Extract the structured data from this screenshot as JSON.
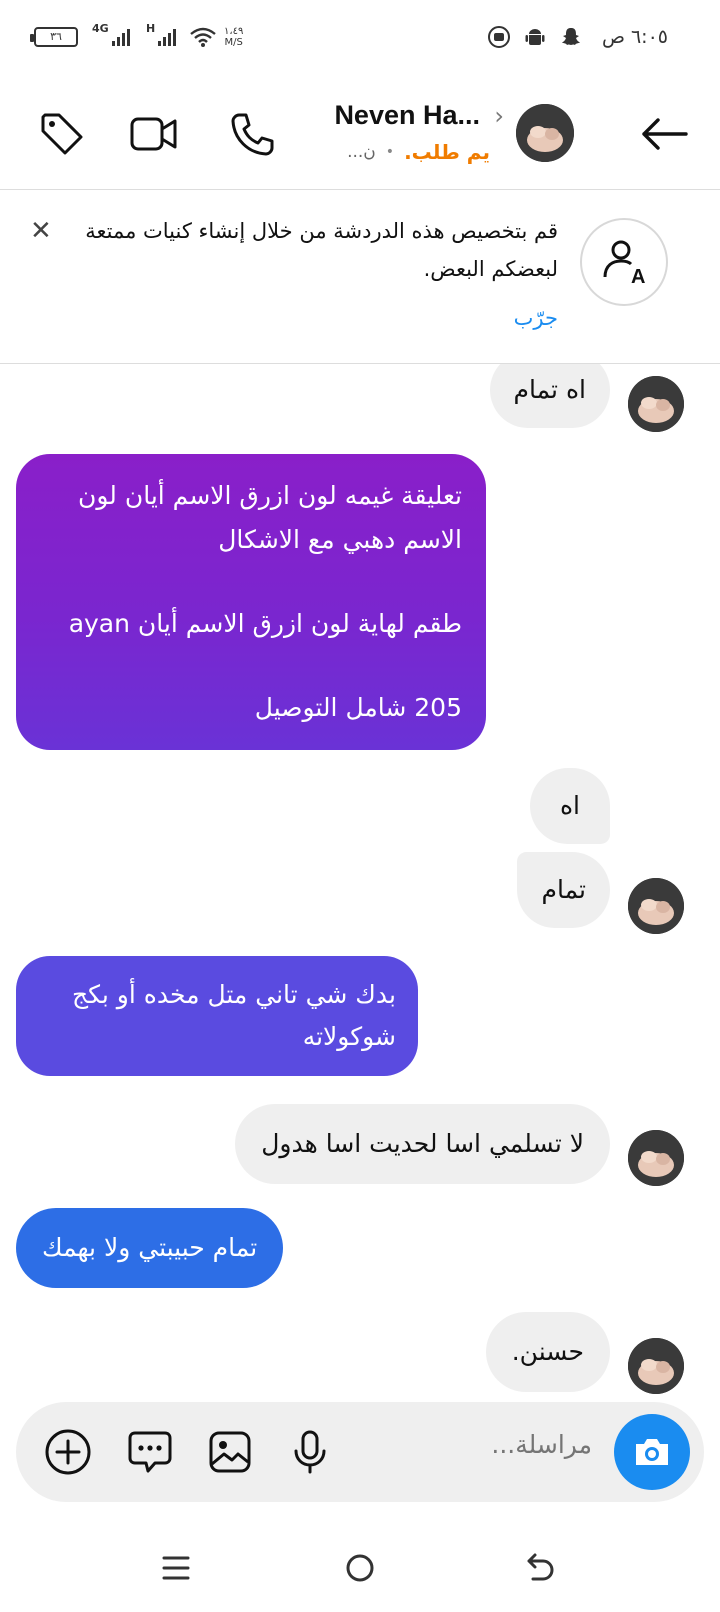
{
  "status_bar": {
    "time": "٦:٠٥ ص",
    "battery": "٣٦",
    "network_1": "4G",
    "network_2": "H",
    "net_speed_value": "١،٤٩",
    "net_speed_unit": "M/S"
  },
  "header": {
    "contact_name": "Neven Ha...",
    "message_request_label": "يم طلب.",
    "status_text": "ن..."
  },
  "banner": {
    "text": "قم بتخصيص هذه الدردشة من خلال إنشاء كنيات ممتعة لبعضكم البعض.",
    "try_label": "جرّب"
  },
  "messages": [
    {
      "text": "اه تمام",
      "direction": "in"
    },
    {
      "line1": "تعليقة غيمه لون ازرق الاسم أيان لون الاسم دهبي مع الاشكال",
      "line2": "طقم لهاية لون ازرق الاسم أيان ayan",
      "line3": "205 شامل التوصيل",
      "direction": "out",
      "color": "#8a1fc9"
    },
    {
      "text": "اه",
      "direction": "in"
    },
    {
      "text": "تمام",
      "direction": "in"
    },
    {
      "text": "بدك شي تاني متل مخده أو بكج شوكولاته",
      "direction": "out",
      "color": "#5a4be0"
    },
    {
      "text": "لا تسلمي اسا لحديت اسا هدول",
      "direction": "in"
    },
    {
      "text": "تمام حبيبتي ولا بهمك",
      "direction": "out",
      "color": "#2d6ee6"
    },
    {
      "text": "حسنن.",
      "direction": "in"
    }
  ],
  "composer": {
    "placeholder": "مراسلة..."
  },
  "colors": {
    "accent_blue": "#1a8cf0",
    "request_orange": "#f07c00",
    "incoming_bubble": "#efefef"
  },
  "icons": [
    "back-arrow-icon",
    "phone-icon",
    "video-icon",
    "tag-icon",
    "nickname-icon",
    "close-icon",
    "camera-icon",
    "mic-icon",
    "gallery-icon",
    "sticker-icon",
    "plus-icon",
    "menu-icon",
    "home-icon",
    "back-nav-icon"
  ]
}
